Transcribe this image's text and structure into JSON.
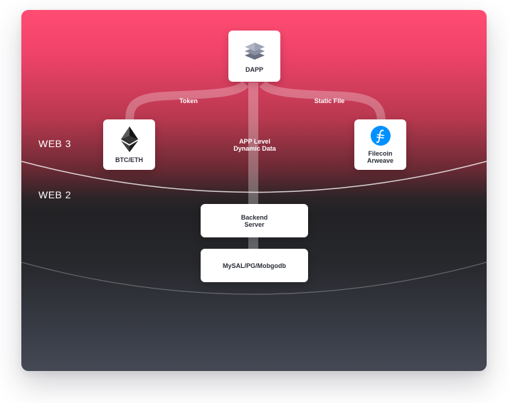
{
  "layers": {
    "web3": "WEB 3",
    "web2": "WEB 2"
  },
  "nodes": {
    "dapp": "DAPP",
    "btc_eth": "BTC/ETH",
    "filecoin": "Filecoin\nArweave",
    "backend": "Backend\nServer",
    "database": "MySAL/PG/Mobgodb"
  },
  "flows": {
    "token": "Token",
    "static_file": "Static File",
    "app_level": "APP Level\nDynamic Data"
  },
  "colors": {
    "top_accent": "#ff4c72",
    "bottom": "#444955",
    "filecoin_blue": "#0090ff"
  },
  "icons": {
    "dapp": "layers-stack-icon",
    "btc_eth": "ethereum-icon",
    "filecoin": "filecoin-icon"
  }
}
